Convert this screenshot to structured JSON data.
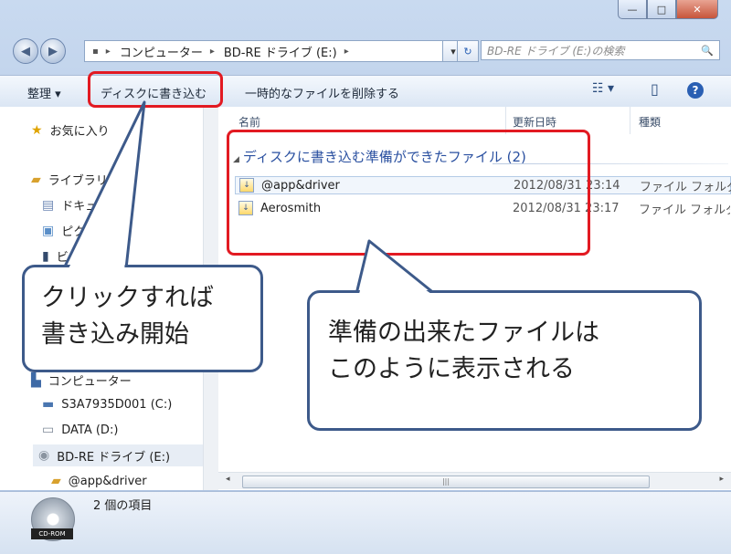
{
  "window": {
    "min_label": "—",
    "max_label": "□",
    "close_label": "✕"
  },
  "address": {
    "back_label": "◀",
    "forward_label": "▶",
    "breadcrumb": [
      "コンピューター",
      "BD-RE ドライブ (E:)"
    ],
    "separator": "▸",
    "dropdown_label": "▾",
    "refresh_label": "↻",
    "search_placeholder": "BD-RE ドライブ (E:)の検索",
    "search_icon": "🔍"
  },
  "toolbar": {
    "organize": "整理 ▾",
    "burn_to_disc": "ディスクに書き込む",
    "delete_temp": "一時的なファイルを削除する",
    "view_icon": "☷ ▾",
    "pane_icon": "▯",
    "help_label": "?"
  },
  "nav": {
    "favorites": "お気に入り",
    "libraries": "ライブラリ",
    "documents": "ドキュメント",
    "pictures": "ピクチャ",
    "videos": "ビデオ",
    "computer": "コンピューター",
    "drive_c": "S3A7935D001 (C:)",
    "drive_d": "DATA (D:)",
    "drive_e": "BD-RE ドライブ (E:)",
    "sub_item": "@app&driver"
  },
  "columns": {
    "name": "名前",
    "date": "更新日時",
    "type": "種類"
  },
  "group": {
    "title": "ディスクに書き込む準備ができたファイル (2)"
  },
  "files": [
    {
      "name": "@app&driver",
      "date": "2012/08/31 23:14",
      "type": "ファイル フォルダー"
    },
    {
      "name": "Aerosmith",
      "date": "2012/08/31 23:17",
      "type": "ファイル フォルダー"
    }
  ],
  "status": {
    "items": "2 個の項目",
    "drive_badge": "CD-ROM"
  },
  "annotations": {
    "bubble_left": [
      "クリックすれば",
      "書き込み開始"
    ],
    "bubble_right": [
      "準備の出来たファイルは",
      "このように表示される"
    ]
  },
  "colors": {
    "highlight": "#e21a22",
    "bubble_border": "#3d5a8a",
    "group_text": "#2a50a0"
  }
}
